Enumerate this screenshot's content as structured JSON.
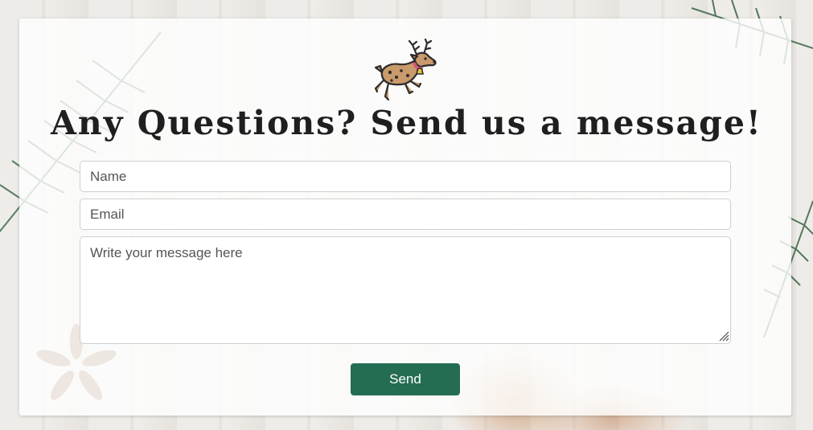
{
  "page": {
    "title": "Any Questions? Send us a message!"
  },
  "form": {
    "name_placeholder": "Name",
    "email_placeholder": "Email",
    "message_placeholder": "Write your message here",
    "send_label": "Send"
  },
  "icons": {
    "logo": "reindeer-icon",
    "resize": "resize-grip-icon"
  },
  "colors": {
    "accent": "#246d52",
    "card": "#ffffff",
    "text": "#1f1f1f"
  }
}
